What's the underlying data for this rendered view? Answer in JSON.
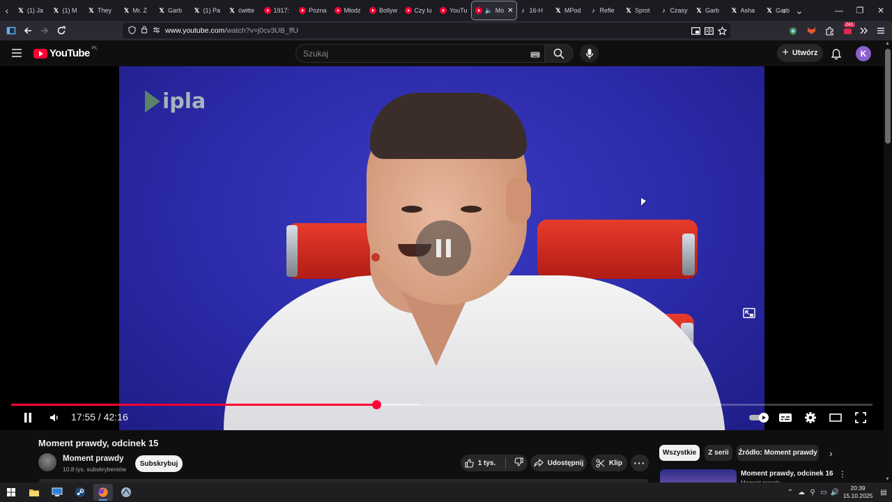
{
  "browser": {
    "tabs": [
      {
        "icon": "x-icon",
        "label": "(1) Ja"
      },
      {
        "icon": "x-icon",
        "label": "(1) M"
      },
      {
        "icon": "x-icon",
        "label": "They"
      },
      {
        "icon": "x-icon",
        "label": "Mr. Z"
      },
      {
        "icon": "x-icon",
        "label": "Garb"
      },
      {
        "icon": "x-icon",
        "label": "(1) Pa"
      },
      {
        "icon": "x-icon",
        "label": "ćwitte"
      },
      {
        "icon": "youtube-icon",
        "label": "1917:"
      },
      {
        "icon": "youtube-icon",
        "label": "Pozna"
      },
      {
        "icon": "youtube-icon",
        "label": "Młodz"
      },
      {
        "icon": "youtube-icon",
        "label": "Bollyw"
      },
      {
        "icon": "youtube-icon",
        "label": "Czy lu"
      },
      {
        "icon": "youtube-icon",
        "label": "YouTu"
      },
      {
        "icon": "youtube-icon",
        "label": "Mo",
        "active": true
      },
      {
        "icon": "tiktok-icon",
        "label": "16-H"
      },
      {
        "icon": "x-icon",
        "label": "MPod"
      },
      {
        "icon": "tiktok-icon",
        "label": "Refle"
      },
      {
        "icon": "x-icon",
        "label": "Sprot"
      },
      {
        "icon": "tiktok-icon",
        "label": "Czasy"
      },
      {
        "icon": "x-icon",
        "label": "Garb"
      },
      {
        "icon": "x-icon",
        "label": "Asha"
      },
      {
        "icon": "x-icon",
        "label": "Garb"
      }
    ],
    "url_host": "www.youtube.com",
    "url_path": "/watch?v=j0cv3UB_ffU",
    "extension_badge": "241"
  },
  "youtube": {
    "logo_text": "YouTube",
    "country_code": "PL",
    "search_placeholder": "Szukaj",
    "create_label": "Utwórz",
    "avatar_letter": "K"
  },
  "player": {
    "watermark": "ipla",
    "current_time": "17:55",
    "duration": "42:16",
    "time_display": "17:55 / 42:16",
    "played_fraction": 0.424,
    "buffered_fraction": 0.473,
    "autoplay": true,
    "accent_color": "#ff0033"
  },
  "video": {
    "title": "Moment prawdy, odcinek 15",
    "channel_name": "Moment prawdy",
    "subscribers": "10,8 tys. subskrybentów",
    "subscribe_label": "Subskrybuj",
    "likes": "1 tys.",
    "share_label": "Udostępnij",
    "clip_label": "Klip"
  },
  "sidebar": {
    "chips": [
      "Wszystkie",
      "Z serii",
      "Źródło: Moment prawdy"
    ],
    "selected_chip": "Wszystkie",
    "recommendation": {
      "title": "Moment prawdy, odcinek 16",
      "channel": "Moment prawdy"
    }
  },
  "taskbar": {
    "time": "20:39",
    "date": "15.10.2025",
    "apps": [
      "windows-start-icon",
      "file-explorer-icon",
      "remote-desktop-icon",
      "steam-icon",
      "firefox-icon",
      "app-icon"
    ]
  }
}
